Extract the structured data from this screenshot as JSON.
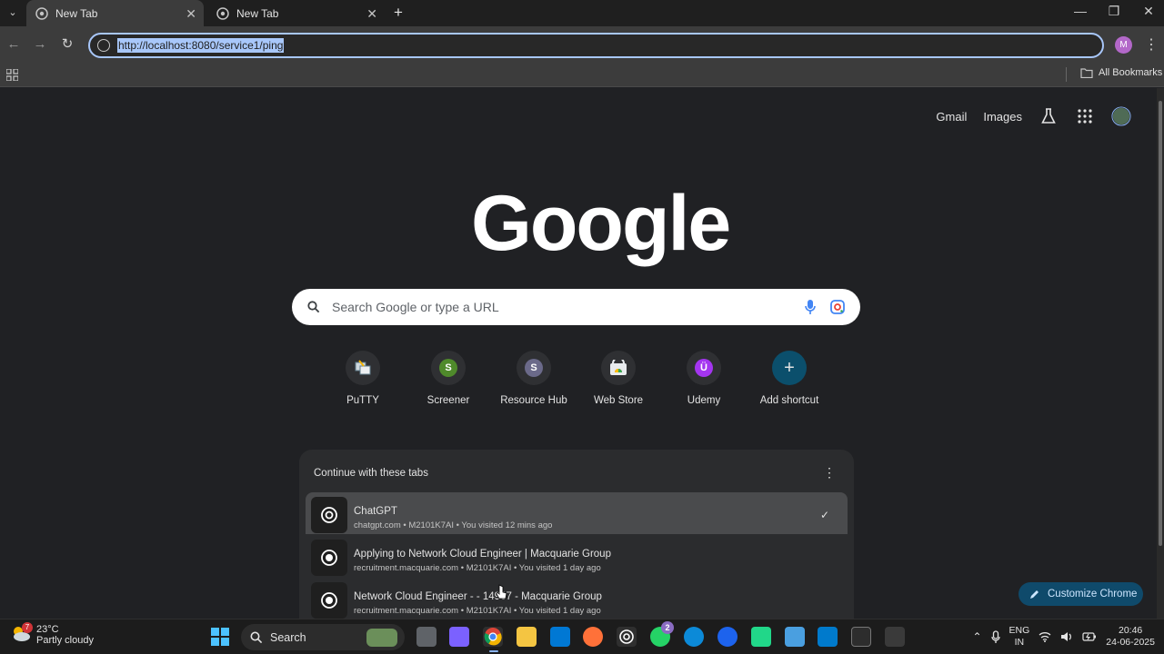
{
  "browser": {
    "tabs": [
      {
        "title": "New Tab",
        "active": true
      },
      {
        "title": "New Tab",
        "active": false
      }
    ],
    "new_tab_glyph": "+",
    "window_controls": {
      "minimize": "—",
      "restore": "❐",
      "close": "✕"
    },
    "nav": {
      "back": "←",
      "forward": "→",
      "reload": "↻"
    },
    "address": "http://localhost:8080/service1/ping",
    "profile_initial": "M",
    "menu_glyph": "⋮",
    "bookmarks": {
      "all_label": "All Bookmarks"
    }
  },
  "ntp": {
    "top_links": {
      "gmail": "Gmail",
      "images": "Images"
    },
    "logo": "Google",
    "search_placeholder": "Search Google or type a URL",
    "shortcuts": [
      {
        "label": "PuTTY",
        "letter": "",
        "color": "#2f3033"
      },
      {
        "label": "Screener",
        "letter": "S",
        "color": "#4f8a2b"
      },
      {
        "label": "Resource Hub",
        "letter": "S",
        "color": "#6b6a8a"
      },
      {
        "label": "Web Store",
        "letter": "",
        "color": "#2f3033"
      },
      {
        "label": "Udemy",
        "letter": "Ü",
        "color": "#a435f0"
      },
      {
        "label": "Add shortcut",
        "letter": "+",
        "color": "#0b4f6c"
      }
    ],
    "continue_tabs": {
      "heading": "Continue with these tabs",
      "menu_glyph": "⋮",
      "items": [
        {
          "title": "ChatGPT",
          "subtitle": "chatgpt.com • M2101K7AI • You visited 12 mins ago",
          "checked": true
        },
        {
          "title": "Applying to Network Cloud Engineer | Macquarie Group",
          "subtitle": "recruitment.macquarie.com • M2101K7AI • You visited 1 day ago",
          "checked": false
        },
        {
          "title": "Network Cloud Engineer - - 14967 - Macquarie Group",
          "subtitle": "recruitment.macquarie.com • M2101K7AI • You visited 1 day ago",
          "checked": false
        }
      ],
      "check_glyph": "✓"
    },
    "customize_label": "Customize Chrome"
  },
  "taskbar": {
    "weather": {
      "temp": "23°C",
      "condition": "Partly cloudy",
      "badge": "7"
    },
    "search_label": "Search",
    "whatsapp_badge": "2",
    "tray": {
      "lang_line1": "ENG",
      "lang_line2": "IN",
      "time": "20:46",
      "date": "24-06-2025"
    }
  }
}
